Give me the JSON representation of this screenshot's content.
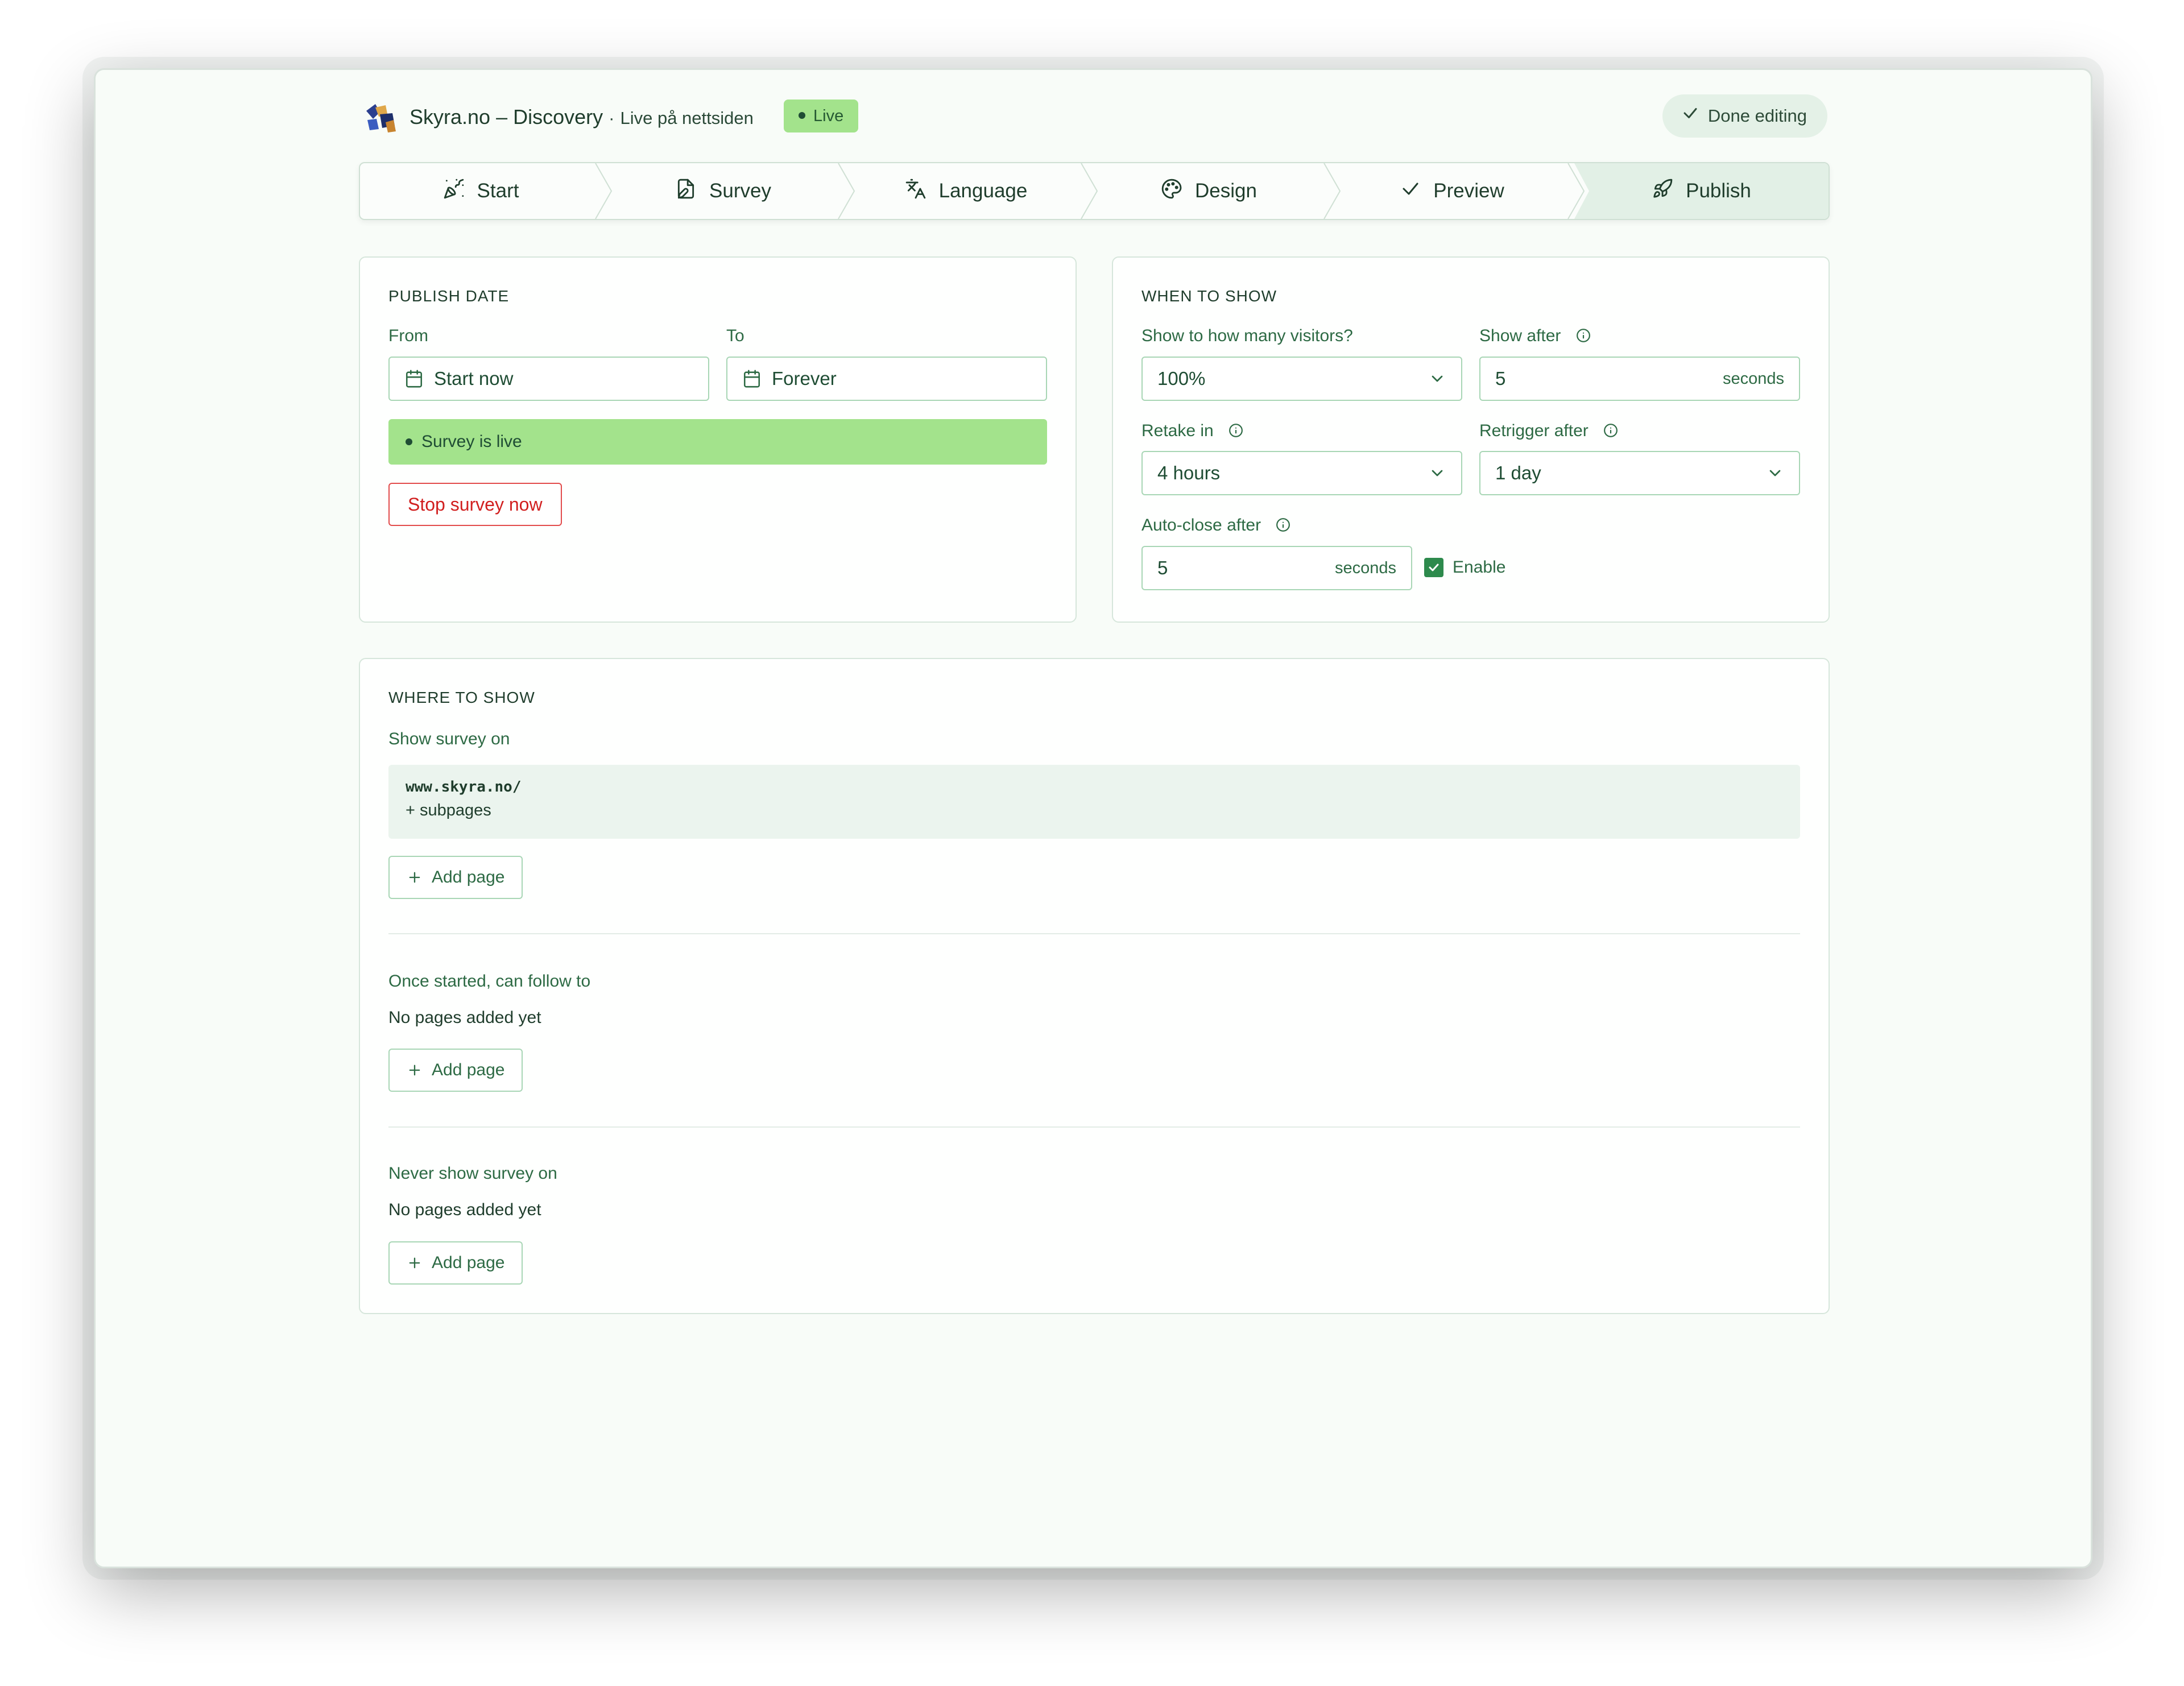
{
  "header": {
    "app_name": "Skyra.no – Discovery",
    "separator": "·",
    "subtitle": "Live på nettsiden",
    "status_badge": "Live",
    "done_label": "Done editing"
  },
  "steps": [
    {
      "label": "Start",
      "icon": "party-popper-icon"
    },
    {
      "label": "Survey",
      "icon": "file-edit-icon"
    },
    {
      "label": "Language",
      "icon": "translate-icon"
    },
    {
      "label": "Design",
      "icon": "palette-icon"
    },
    {
      "label": "Preview",
      "icon": "check-icon"
    },
    {
      "label": "Publish",
      "icon": "rocket-icon"
    }
  ],
  "active_step": "Publish",
  "publish_date": {
    "title": "PUBLISH DATE",
    "from_label": "From",
    "from_value": "Start now",
    "to_label": "To",
    "to_value": "Forever",
    "live_status": "Survey is live",
    "stop_label": "Stop survey now"
  },
  "when_to_show": {
    "title": "WHEN TO SHOW",
    "visitors_label": "Show to how many visitors?",
    "visitors_value": "100%",
    "show_after_label": "Show after",
    "show_after_value": "5",
    "show_after_unit": "seconds",
    "retake_label": "Retake in",
    "retake_value": "4 hours",
    "retrigger_label": "Retrigger after",
    "retrigger_value": "1 day",
    "autoclose_label": "Auto-close after",
    "autoclose_value": "5",
    "autoclose_unit": "seconds",
    "enable_label": "Enable",
    "enable_checked": true
  },
  "where_to_show": {
    "title": "WHERE TO SHOW",
    "show_on_label": "Show survey on",
    "show_on_url": "www.skyra.no/",
    "show_on_sub": "+ subpages",
    "add_page_label": "Add page",
    "follow_label": "Once started, can follow to",
    "follow_empty": "No pages added yet",
    "never_label": "Never show survey on",
    "never_empty": "No pages added yet"
  },
  "colors": {
    "accent": "#2d6a44",
    "live": "#a3e38c",
    "danger": "#d11f1f",
    "background": "#f8fcf8"
  }
}
